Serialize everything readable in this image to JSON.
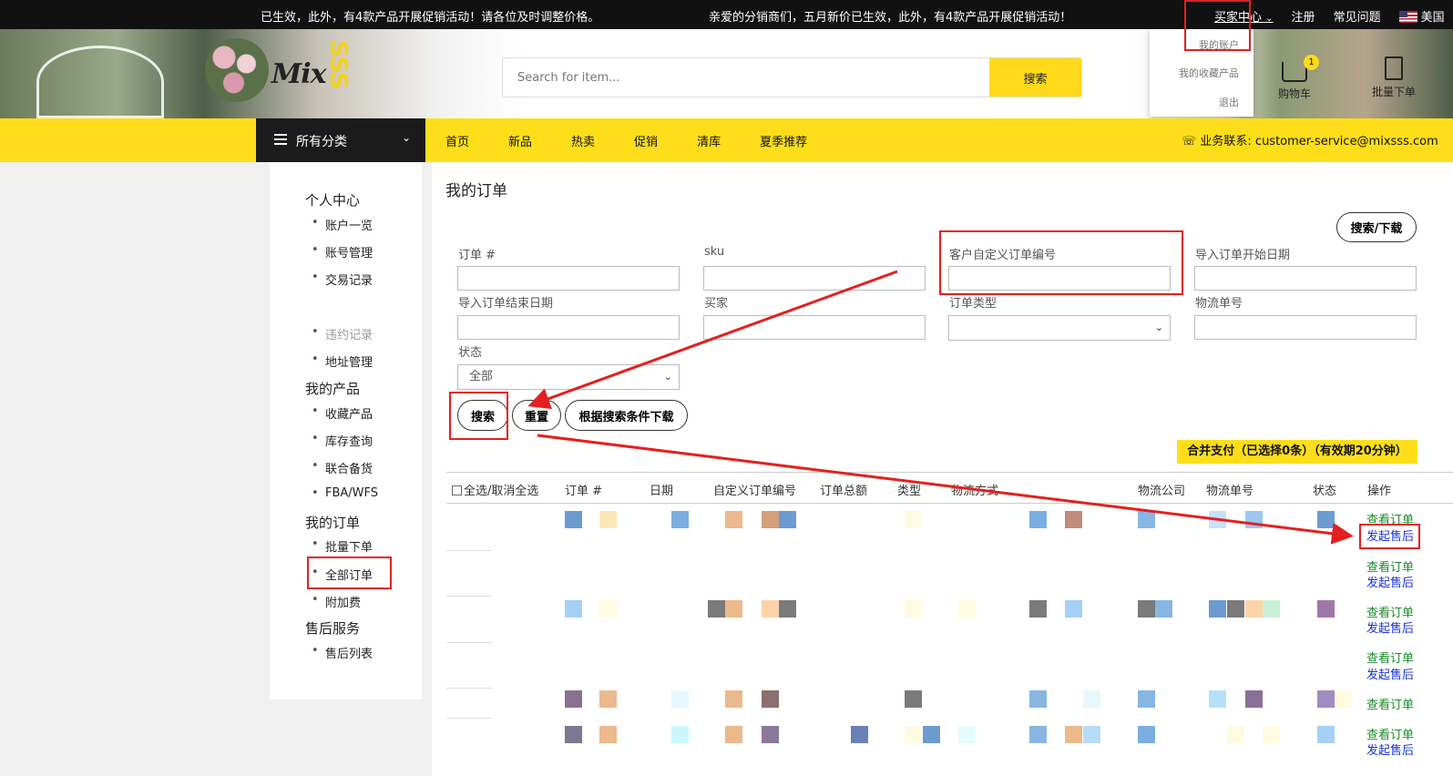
{
  "topbar": {
    "notice_left": "已生效，此外，有4款产品开展促销活动！请各位及时调整价格。",
    "notice_right": "亲爱的分销商们，五月新价已生效，此外，有4款产品开展促销活动！",
    "buyer_center": "买家中心",
    "register": "注册",
    "faq": "常见问题",
    "region": "美国"
  },
  "account_menu": {
    "my_account": "我的账户",
    "favorites": "我的收藏产品",
    "logout": "退出"
  },
  "header": {
    "logo": "Mix",
    "logo_accent": "SSS",
    "search_placeholder": "Search for item...",
    "search_button": "搜索",
    "cart_label": "购物车",
    "cart_count": "1",
    "batch_label": "批量下单"
  },
  "nav": {
    "all_categories": "所有分类",
    "links": [
      "首页",
      "新品",
      "热卖",
      "促销",
      "清库",
      "夏季推荐"
    ],
    "contact": "业务联系: customer-service@mixsss.com"
  },
  "sidebar": {
    "personal_center": "个人中心",
    "account_overview": "账户一览",
    "account_manage": "账号管理",
    "transactions": "交易记录",
    "violations": "违约记录",
    "address": "地址管理",
    "my_products": "我的产品",
    "favorite_products": "收藏产品",
    "inventory": "库存查询",
    "joint_stock": "联合备货",
    "fba": "FBA/WFS",
    "my_orders": "我的订单",
    "batch_order": "批量下单",
    "all_orders": "全部订单",
    "surcharge": "附加费",
    "after_sales": "售后服务",
    "after_sales_list": "售后列表"
  },
  "main": {
    "title": "我的订单",
    "search_download": "搜索/下载",
    "filters": {
      "order_no": "订单 #",
      "sku": "sku",
      "custom_order_no": "客户自定义订单编号",
      "import_start": "导入订单开始日期",
      "import_end": "导入订单结束日期",
      "buyer": "买家",
      "order_type": "订单类型",
      "tracking_no": "物流单号",
      "status": "状态",
      "status_value": "全部"
    },
    "buttons": {
      "search": "搜索",
      "reset": "重置",
      "download_by_filter": "根据搜索条件下载"
    },
    "merge_pay": "合并支付（已选择0条）（有效期20分钟）",
    "table": {
      "headers": {
        "select_all": "全选/取消全选",
        "order_no": "订单 #",
        "date": "日期",
        "custom_no": "自定义订单编号",
        "total": "订单总额",
        "type": "类型",
        "shipping_method": "物流方式",
        "carrier": "物流公司",
        "tracking": "物流单号",
        "status": "状态",
        "action": "操作"
      },
      "actions": {
        "view": "查看订单",
        "after_sale": "发起售后"
      }
    }
  },
  "colors": {
    "accent_yellow": "#fede1a",
    "annotation_red": "#e41f1f",
    "view_link": "#1a8a2a",
    "after_sale_link": "#1a33d6"
  }
}
